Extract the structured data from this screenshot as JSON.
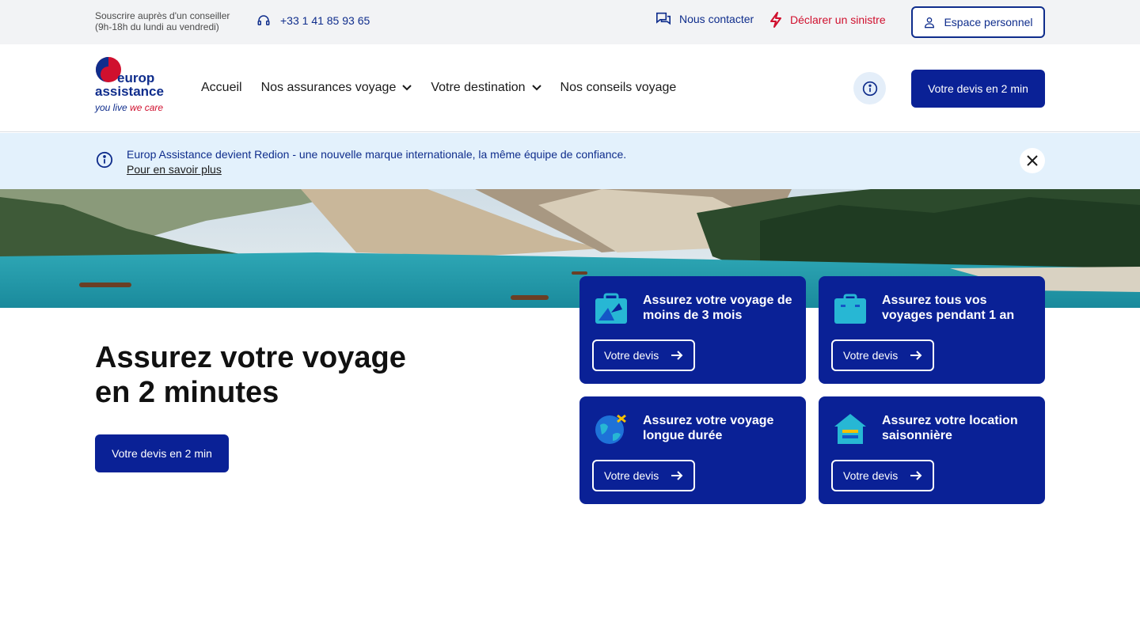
{
  "topbar": {
    "subscribe_line1": "Souscrire auprès d'un conseiller",
    "subscribe_line2": "(9h-18h du lundi au vendredi)",
    "phone": "+33 1 41 85 93 65",
    "contact": "Nous contacter",
    "sinistre": "Déclarer un sinistre",
    "espace": "Espace personnel"
  },
  "logo": {
    "line1": "europ",
    "line2": "assistance",
    "tag_part1": "you live ",
    "tag_part2": "we care"
  },
  "nav": {
    "items": [
      {
        "label": "Accueil"
      },
      {
        "label": "Nos assurances voyage"
      },
      {
        "label": "Votre destination"
      },
      {
        "label": "Nos conseils voyage"
      }
    ]
  },
  "header": {
    "cta": "Votre devis en 2 min"
  },
  "banner": {
    "text": "Europ Assistance devient Redion - une nouvelle marque internationale, la même équipe de confiance.",
    "link": "Pour en savoir plus"
  },
  "hero": {
    "title_line1": "Assurez votre voyage",
    "title_line2": "en 2 minutes",
    "cta": "Votre devis en 2 min"
  },
  "cards": [
    {
      "title": "Assurez votre voyage de moins de 3 mois",
      "button": "Votre devis",
      "icon": "suitcase-icon"
    },
    {
      "title": "Assurez tous vos voyages pendant 1 an",
      "button": "Votre devis",
      "icon": "briefcase-icon"
    },
    {
      "title": "Assurez votre voyage longue durée",
      "button": "Votre devis",
      "icon": "globe-plane-icon"
    },
    {
      "title": "Assurez votre location saisonnière",
      "button": "Votre devis",
      "icon": "house-icon"
    }
  ],
  "colors": {
    "primary": "#0a2196",
    "accent_red": "#d0102e",
    "banner_bg": "#e3f1fc"
  }
}
